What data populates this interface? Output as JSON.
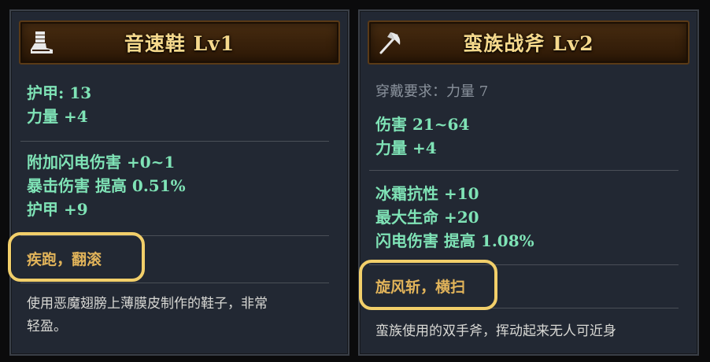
{
  "left_card": {
    "title": "音速鞋 Lv1",
    "icon": "armor-boots-icon",
    "stats": [
      "护甲: 13",
      "力量 +4"
    ],
    "bonuses": [
      "附加闪电伤害 +0~1",
      "暴击伤害 提高 0.51%",
      "护甲 +9"
    ],
    "skills": "疾跑，翻滚",
    "description_1": "使用恶魔翅膀上薄膜皮制作的鞋子，非常",
    "description_2": "轻盈。"
  },
  "right_card": {
    "title": "蛮族战斧 Lv2",
    "icon": "axe-icon",
    "requirement": "穿戴要求：力量 7",
    "stats": [
      "伤害 21~64",
      "力量 +4"
    ],
    "bonuses": [
      "冰霜抗性 +10",
      "最大生命 +20",
      "闪电伤害 提高 1.08%"
    ],
    "skills": "旋风斩，横扫",
    "description_1": "蛮族使用的双手斧，挥动起来无人可近身"
  },
  "colors": {
    "stat_green": "#7fe3b6",
    "skill_gold": "#e2b45a",
    "highlight_yellow": "#f2cf6a",
    "title_gold": "#f6d98c"
  }
}
